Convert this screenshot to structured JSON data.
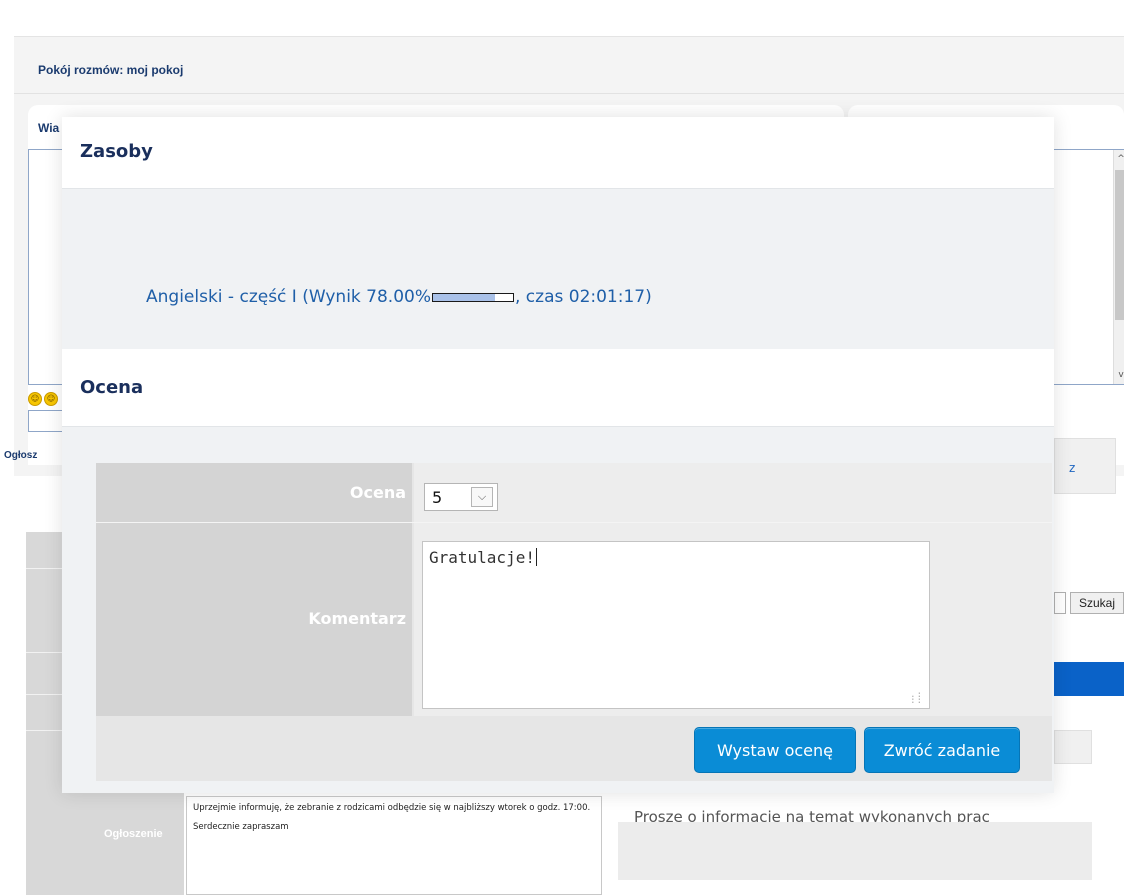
{
  "background": {
    "room_title": "Pokój rozmów: moj pokoj",
    "panel_partial_label": "Wia",
    "announcements_partial_label": "Ogłosz",
    "right_link_partial": "z",
    "search_button": "Szukaj",
    "announcement_label": "Ogłoszenie",
    "announcement_line1": "Uprzejmie informuję, że zebranie z rodzicami odbędzie się w najbliższy wtorek o godz. 17:00.",
    "announcement_line2": "Serdecznie zapraszam",
    "right_partial_text": "Proszę o informację na temat wykonanych prac",
    "smileys": [
      "smiley-icon",
      "smiley-icon"
    ],
    "scroll_up_glyph": "^",
    "scroll_down_glyph": "v",
    "colors": {
      "accent_blue": "#0a62c8",
      "title_navy": "#1a3a6e"
    }
  },
  "modal": {
    "resources_title": "Zasoby",
    "resource": {
      "link_prefix": "Angielski - część I (Wynik 78.00%",
      "link_suffix": ", czas 02:01:17)",
      "score_fraction": 0.78
    },
    "grading_title": "Ocena",
    "grade_label": "Ocena",
    "grade_value": "5",
    "grade_arrow_glyph": "⌵",
    "comment_label": "Komentarz",
    "comment_value": "Gratulacje!",
    "grade_button": "Wystaw ocenę",
    "return_button": "Zwróć zadanie",
    "colors": {
      "button_blue": "#0a8cd6",
      "link_blue": "#1f5fa8",
      "title_navy": "#1a2f5c"
    }
  }
}
